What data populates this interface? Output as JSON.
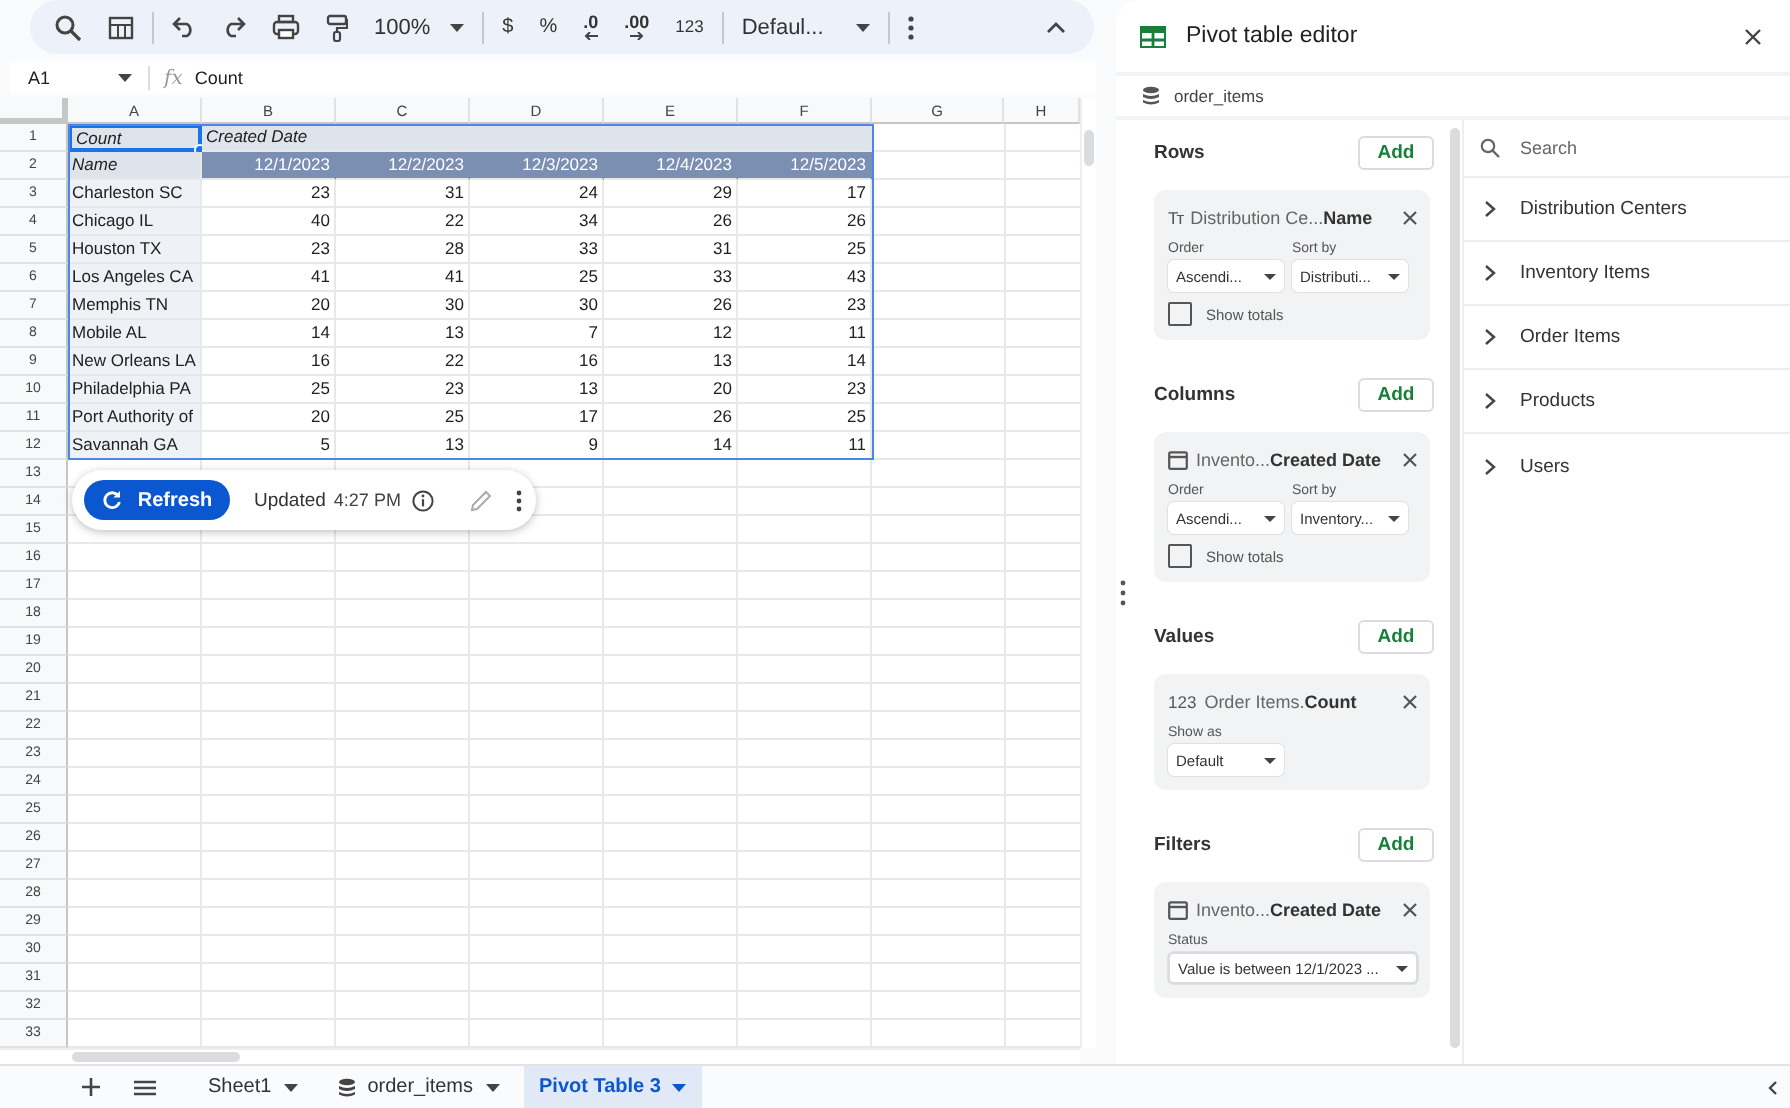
{
  "toolbar": {
    "zoom": "100%",
    "currency": "$",
    "percent": "%",
    "decrease_decimals": ".0",
    "increase_decimals": ".00",
    "number_format": "123",
    "font": "Defaul..."
  },
  "formula_bar": {
    "cell": "A1",
    "fx": "fx",
    "value": "Count"
  },
  "grid": {
    "columns": [
      "A",
      "B",
      "C",
      "D",
      "E",
      "F",
      "G",
      "H"
    ],
    "rows": [
      {
        "num": "1",
        "kind": "title",
        "cells": [
          {
            "text": "Count",
            "selected": true
          },
          {
            "text": "Created Date",
            "selected": false
          }
        ]
      },
      {
        "num": "2",
        "kind": "header",
        "cells": [
          "Name",
          "12/1/2023",
          "12/2/2023",
          "12/3/2023",
          "12/4/2023",
          "12/5/2023"
        ]
      },
      {
        "num": "3",
        "kind": "data",
        "cells": [
          "Charleston SC",
          "23",
          "31",
          "24",
          "29",
          "17"
        ]
      },
      {
        "num": "4",
        "kind": "data",
        "cells": [
          "Chicago IL",
          "40",
          "22",
          "34",
          "26",
          "26"
        ]
      },
      {
        "num": "5",
        "kind": "data",
        "cells": [
          "Houston TX",
          "23",
          "28",
          "33",
          "31",
          "25"
        ]
      },
      {
        "num": "6",
        "kind": "data",
        "cells": [
          "Los Angeles CA",
          "41",
          "41",
          "25",
          "33",
          "43"
        ]
      },
      {
        "num": "7",
        "kind": "data",
        "cells": [
          "Memphis TN",
          "20",
          "30",
          "30",
          "26",
          "23"
        ]
      },
      {
        "num": "8",
        "kind": "data",
        "cells": [
          "Mobile AL",
          "14",
          "13",
          "7",
          "12",
          "11"
        ]
      },
      {
        "num": "9",
        "kind": "data",
        "cells": [
          "New Orleans LA",
          "16",
          "22",
          "16",
          "13",
          "14"
        ]
      },
      {
        "num": "10",
        "kind": "data",
        "cells": [
          "Philadelphia PA",
          "25",
          "23",
          "13",
          "20",
          "23"
        ]
      },
      {
        "num": "11",
        "kind": "data",
        "cells": [
          "Port Authority of",
          "20",
          "25",
          "17",
          "26",
          "25"
        ]
      },
      {
        "num": "12",
        "kind": "data",
        "cells": [
          "Savannah GA",
          "5",
          "13",
          "9",
          "14",
          "11"
        ]
      },
      {
        "num": "13",
        "kind": "blank"
      },
      {
        "num": "14",
        "kind": "blank"
      },
      {
        "num": "15",
        "kind": "blank"
      },
      {
        "num": "16",
        "kind": "blank"
      },
      {
        "num": "17",
        "kind": "blank"
      },
      {
        "num": "18",
        "kind": "blank"
      },
      {
        "num": "19",
        "kind": "blank"
      },
      {
        "num": "20",
        "kind": "blank"
      },
      {
        "num": "21",
        "kind": "blank"
      },
      {
        "num": "22",
        "kind": "blank"
      },
      {
        "num": "23",
        "kind": "blank"
      },
      {
        "num": "24",
        "kind": "blank"
      },
      {
        "num": "25",
        "kind": "blank"
      },
      {
        "num": "26",
        "kind": "blank"
      },
      {
        "num": "27",
        "kind": "blank"
      },
      {
        "num": "28",
        "kind": "blank"
      },
      {
        "num": "29",
        "kind": "blank"
      },
      {
        "num": "30",
        "kind": "blank"
      },
      {
        "num": "31",
        "kind": "blank"
      },
      {
        "num": "32",
        "kind": "blank"
      },
      {
        "num": "33",
        "kind": "blank"
      }
    ]
  },
  "refresh_card": {
    "button": "Refresh",
    "updated": "Updated",
    "time": "4:27 PM"
  },
  "sheet_tabs": [
    {
      "label": "Sheet1",
      "kind": "sheet",
      "selected": false
    },
    {
      "label": "order_items",
      "kind": "data-source",
      "selected": false
    },
    {
      "label": "Pivot Table 3",
      "kind": "sheet",
      "selected": true
    }
  ],
  "editor": {
    "title": "Pivot table editor",
    "source": "order_items",
    "sections": [
      {
        "title": "Rows",
        "add": "Add",
        "fields": [
          {
            "kind": "text",
            "glyph": "Tт",
            "source": "Distribution Ce...",
            "name": "Name",
            "controls": [
              {
                "label": "Order",
                "value": "Ascendi...",
                "kind": "half"
              },
              {
                "label": "Sort by",
                "value": "Distributi...",
                "kind": "half"
              }
            ],
            "totals": {
              "label": "Show totals",
              "checked": false
            }
          }
        ]
      },
      {
        "title": "Columns",
        "add": "Add",
        "fields": [
          {
            "kind": "date",
            "source": "Invento...",
            "name": "Created Date",
            "controls": [
              {
                "label": "Order",
                "value": "Ascendi...",
                "kind": "half"
              },
              {
                "label": "Sort by",
                "value": "Inventory...",
                "kind": "half"
              }
            ],
            "totals": {
              "label": "Show totals",
              "checked": false
            }
          }
        ]
      },
      {
        "title": "Values",
        "add": "Add",
        "fields": [
          {
            "kind": "number",
            "glyph": "123",
            "source": "Order Items.",
            "name": "Count",
            "controls": [
              {
                "label": "Show as",
                "value": "Default",
                "kind": "half"
              }
            ]
          }
        ]
      },
      {
        "title": "Filters",
        "add": "Add",
        "fields": [
          {
            "kind": "date",
            "source": "Invento...",
            "name": "Created Date",
            "controls": [
              {
                "label": "Status",
                "value": "Value is between 12/1/2023 ...",
                "kind": "full"
              }
            ]
          }
        ]
      }
    ],
    "search_placeholder": "Search",
    "tables": [
      {
        "label": "Distribution Centers",
        "expanded": false
      },
      {
        "label": "Inventory Items",
        "expanded": false
      },
      {
        "label": "Order Items",
        "expanded": false
      },
      {
        "label": "Products",
        "expanded": false
      },
      {
        "label": "Users",
        "expanded": false
      }
    ]
  }
}
